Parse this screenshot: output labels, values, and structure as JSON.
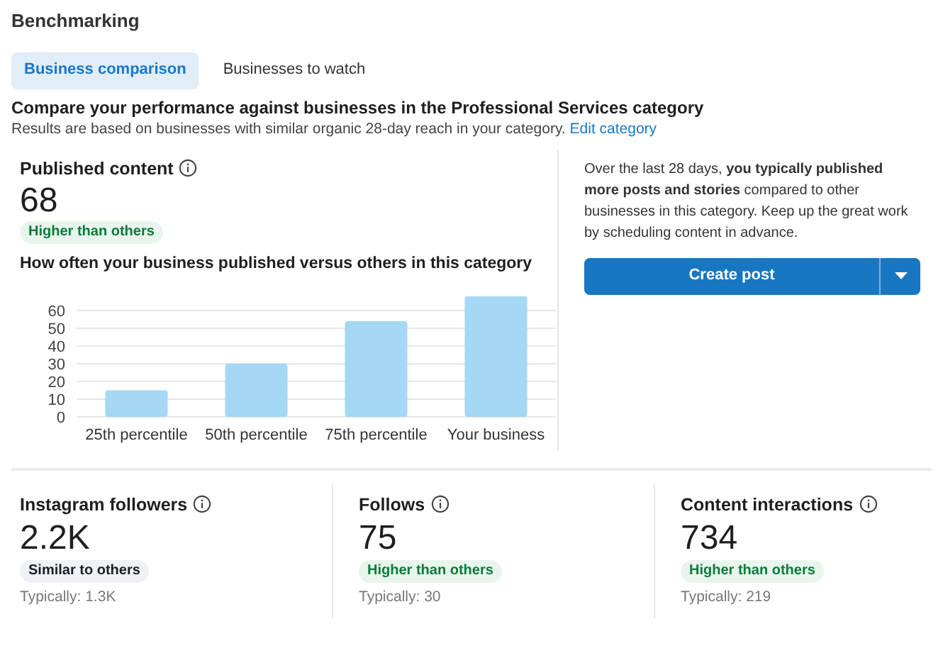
{
  "title": "Benchmarking",
  "tabs": [
    {
      "label": "Business comparison",
      "selected": true
    },
    {
      "label": "Businesses to watch",
      "selected": false
    }
  ],
  "heading": "Compare your performance against businesses in the Professional Services category",
  "subheading": "Results are based on businesses with similar organic 28-day reach in your category.",
  "subheading_link": "Edit category",
  "published": {
    "label": "Published content",
    "value": "68",
    "badge": {
      "text": "Higher than others",
      "kind": "higher"
    },
    "chart_data": {
      "type": "bar",
      "title": "How often your business published versus others in this category",
      "categories": [
        "25th percentile",
        "50th percentile",
        "75th percentile",
        "Your business"
      ],
      "values": [
        15,
        30,
        54,
        68
      ],
      "ylim": [
        0,
        68
      ],
      "grid": true,
      "yticks": [
        0,
        10,
        20,
        30,
        40,
        50,
        60
      ]
    }
  },
  "insight": "Over the last 28 days, **you typically published more posts and stories** compared to other businesses in this category. Keep up the great work by scheduling content in advance.",
  "create_button": "Create post",
  "stats": [
    {
      "label": "Instagram followers",
      "value": "2.2K",
      "badge": {
        "text": "Similar to others",
        "kind": "similar"
      },
      "typical": "Typically: 1.3K"
    },
    {
      "label": "Follows",
      "value": "75",
      "badge": {
        "text": "Higher than others",
        "kind": "higher"
      },
      "typical": "Typically: 30"
    },
    {
      "label": "Content interactions",
      "value": "734",
      "badge": {
        "text": "Higher than others",
        "kind": "higher"
      },
      "typical": "Typically: 219"
    }
  ]
}
